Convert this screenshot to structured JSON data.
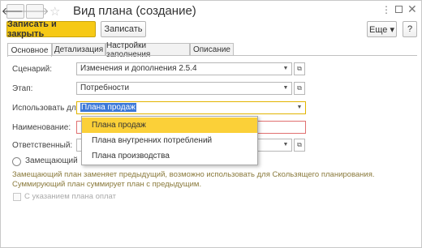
{
  "window": {
    "title": "Вид плана (создание)",
    "nav_back": "🡐",
    "nav_forward": "🡒",
    "star": "☆",
    "menu": "⋮",
    "close": "✕"
  },
  "toolbar": {
    "save_close_label": "Записать и закрыть",
    "save_label": "Записать",
    "more_label": "Еще ▾",
    "help_label": "?"
  },
  "tabs": [
    {
      "label": "Основное",
      "active": true
    },
    {
      "label": "Детализация",
      "active": false
    },
    {
      "label": "Настройки заполнения",
      "active": false
    },
    {
      "label": "Описание",
      "active": false
    }
  ],
  "form": {
    "scenario_label": "Сценарий:",
    "scenario_value": "Изменения и дополнения 2.5.4",
    "stage_label": "Этап:",
    "stage_value": "Потребности",
    "use_for_label": "Использовать для:",
    "use_for_value": "Плана продаж",
    "name_label": "Наименование:",
    "name_value": "",
    "responsible_label": "Ответственный:",
    "responsible_value": "",
    "replacing_label": "Замещающий",
    "hint_line1": "Замещающий план заменяет предыдущий, возможно использовать для Скользящего планирования.",
    "hint_line2": "Суммирующий план суммирует план с предыдущим.",
    "with_payment_label": "С указанием плана оплат"
  },
  "dropdown": {
    "options": [
      "Плана продаж",
      "Плана внутренних потреблений",
      "Плана производства"
    ],
    "selected": "Плана продаж"
  },
  "colors": {
    "accent": "#f6c915",
    "highlight": "#fbd038",
    "hint_text": "#8a7a3c"
  }
}
